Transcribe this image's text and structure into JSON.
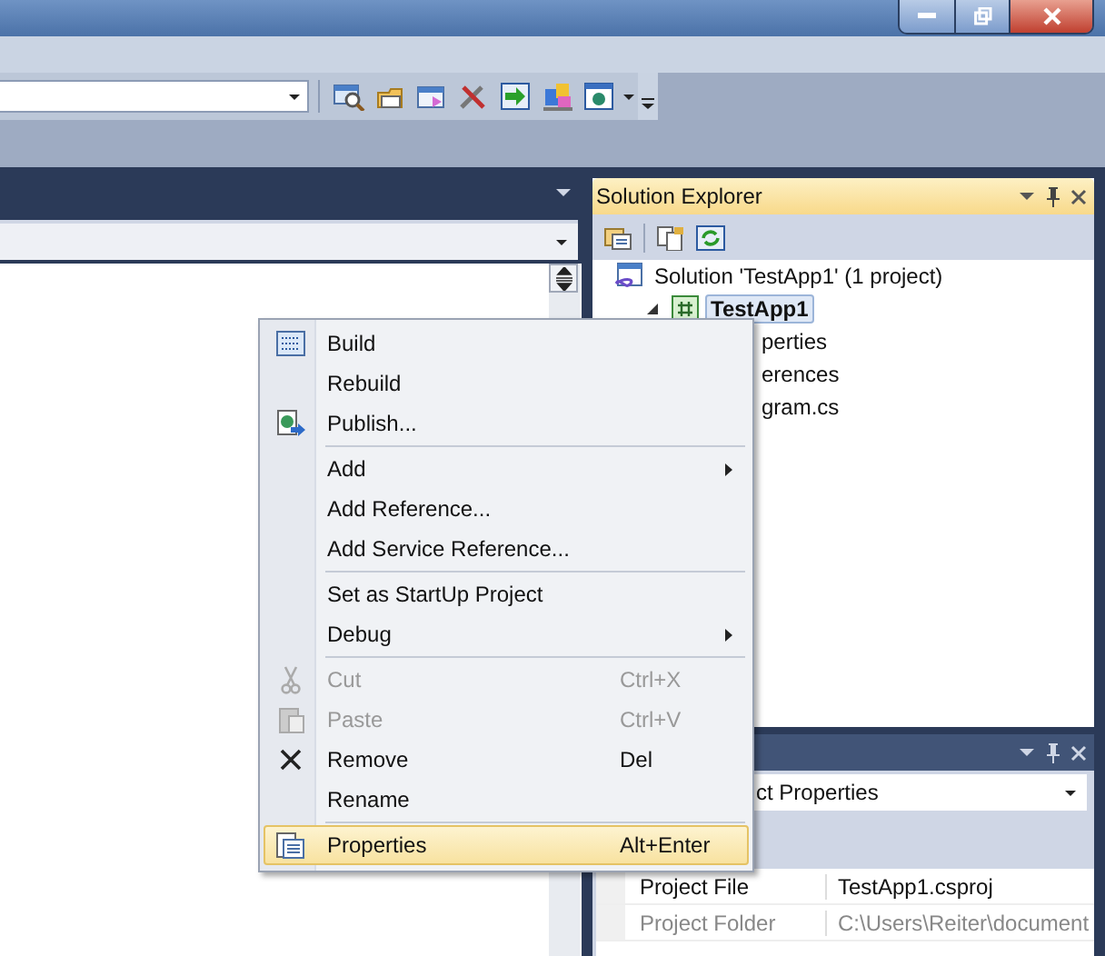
{
  "solution_explorer": {
    "title": "Solution Explorer",
    "tree": [
      {
        "label": "Solution 'TestApp1' (1 project)",
        "selected": false,
        "expanded": true,
        "children": [
          {
            "label": "TestApp1",
            "selected": true,
            "expanded": true,
            "children": [
              {
                "label": "perties",
                "selected": false
              },
              {
                "label": "erences",
                "selected": false
              },
              {
                "label": "gram.cs",
                "selected": false
              }
            ]
          }
        ]
      }
    ]
  },
  "properties_panel": {
    "combo": {
      "value": "ct Properties"
    },
    "rows": [
      {
        "name": "Project File",
        "value": "TestApp1.csproj",
        "disabled": false
      },
      {
        "name": "Project Folder",
        "value": "C:\\Users\\Reiter\\document",
        "disabled": true
      }
    ]
  },
  "context_menu": {
    "groups": [
      [
        {
          "label": "Build",
          "disabled": false,
          "selected": false
        },
        {
          "label": "Rebuild",
          "disabled": false,
          "selected": false
        },
        {
          "label": "Publish...",
          "disabled": false,
          "selected": false
        }
      ],
      [
        {
          "label": "Add",
          "submenu": true,
          "disabled": false,
          "selected": false
        },
        {
          "label": "Add Reference...",
          "disabled": false,
          "selected": false
        },
        {
          "label": "Add Service Reference...",
          "disabled": false,
          "selected": false
        }
      ],
      [
        {
          "label": "Set as StartUp Project",
          "disabled": false,
          "selected": false
        },
        {
          "label": "Debug",
          "submenu": true,
          "disabled": false,
          "selected": false
        }
      ],
      [
        {
          "label": "Cut",
          "shortcut": "Ctrl+X",
          "disabled": true,
          "selected": false
        },
        {
          "label": "Paste",
          "shortcut": "Ctrl+V",
          "disabled": true,
          "selected": false
        },
        {
          "label": "Remove",
          "shortcut": "Del",
          "disabled": false,
          "selected": false
        },
        {
          "label": "Rename",
          "disabled": false,
          "selected": false
        }
      ],
      [
        {
          "label": "Properties",
          "shortcut": "Alt+Enter",
          "disabled": false,
          "selected": true
        }
      ]
    ]
  }
}
